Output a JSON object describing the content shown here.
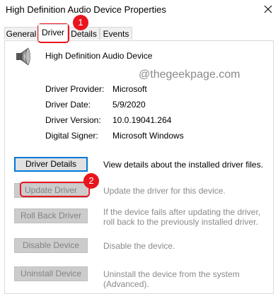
{
  "window": {
    "title": "High Definition Audio Device Properties",
    "close_icon": "close-icon"
  },
  "tabs": [
    {
      "label": "General",
      "active": false
    },
    {
      "label": "Driver",
      "active": true
    },
    {
      "label": "Details",
      "active": false
    },
    {
      "label": "Events",
      "active": false
    }
  ],
  "device": {
    "icon": "speaker-icon",
    "name": "High Definition Audio Device"
  },
  "watermark": "@thegeekpage.com",
  "properties": [
    {
      "label": "Driver Provider:",
      "value": "Microsoft"
    },
    {
      "label": "Driver Date:",
      "value": "5/9/2020"
    },
    {
      "label": "Driver Version:",
      "value": "10.0.19041.264"
    },
    {
      "label": "Digital Signer:",
      "value": "Microsoft Windows"
    }
  ],
  "actions": [
    {
      "label": "Driver Details",
      "description": "View details about the installed driver files.",
      "enabled": true
    },
    {
      "label": "Update Driver",
      "description": "Update the driver for this device.",
      "enabled": false
    },
    {
      "label": "Roll Back Driver",
      "description": "If the device fails after updating the driver, roll back to the previously installed driver.",
      "enabled": false
    },
    {
      "label": "Disable Device",
      "description": "Disable the device.",
      "enabled": false
    },
    {
      "label": "Uninstall Device",
      "description": "Uninstall the device from the system (Advanced).",
      "enabled": false
    }
  ],
  "annotations": [
    {
      "number": "1"
    },
    {
      "number": "2"
    }
  ],
  "colors": {
    "annotation": "#e8141e",
    "focus": "#0078d7"
  }
}
